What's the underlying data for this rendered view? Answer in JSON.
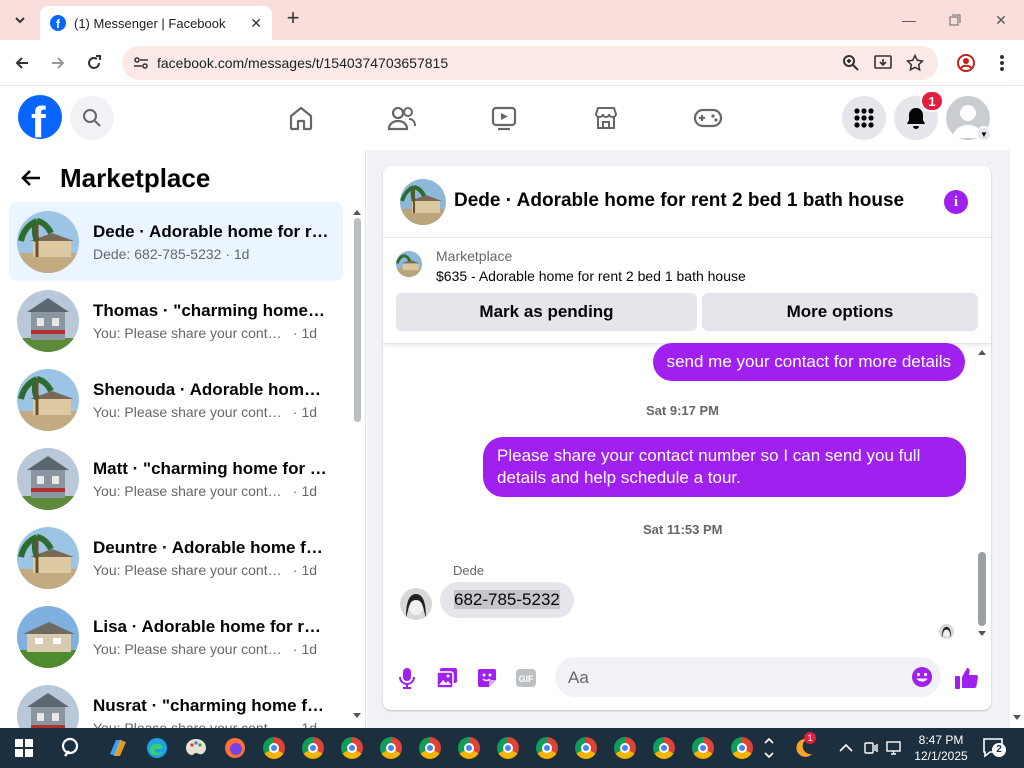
{
  "browser": {
    "tab_title": "(1) Messenger | Facebook",
    "url": "facebook.com/messages/t/1540374703657815"
  },
  "header": {
    "notification_count": "1"
  },
  "left_panel": {
    "title": "Marketplace",
    "conversations": [
      {
        "name": "Dede · Adorable home for re...",
        "preview": "Dede: 682-785-5232",
        "time": "1d",
        "thumb": "palm"
      },
      {
        "name": "Thomas · \"charming home f...",
        "preview": "You: Please share your contact ...",
        "time": "1d",
        "thumb": "gray"
      },
      {
        "name": "Shenouda · Adorable home ...",
        "preview": "You: Please share your contact ...",
        "time": "1d",
        "thumb": "palm"
      },
      {
        "name": "Matt · \"charming home for r...",
        "preview": "You: Please share your contact ...",
        "time": "1d",
        "thumb": "gray"
      },
      {
        "name": "Deuntre · Adorable home fo...",
        "preview": "You: Please share your contact ...",
        "time": "1d",
        "thumb": "palm"
      },
      {
        "name": "Lisa · Adorable home for ren...",
        "preview": "You: Please share your contact ...",
        "time": "1d",
        "thumb": "beige"
      },
      {
        "name": "Nusrat · \"charming home fo...",
        "preview": "You: Please share your contact ...",
        "time": "1d",
        "thumb": "gray"
      }
    ]
  },
  "chat": {
    "title": "Dede · Adorable home for rent 2 bed 1 bath house",
    "marketplace_label": "Marketplace",
    "listing": "$635 - Adorable home for rent 2 bed 1 bath house",
    "mark_pending_label": "Mark as pending",
    "more_options_label": "More options",
    "messages": {
      "out_1": "send me your contact for more details",
      "timestamp_1": "Sat 9:17 PM",
      "out_2_line1": "Please share your contact number so I can send you full",
      "out_2_line2": "details and help schedule a tour.",
      "timestamp_2": "Sat 11:53 PM",
      "sender": "Dede",
      "in_1": "682-785-5232"
    },
    "composer_placeholder": "Aa"
  },
  "taskbar": {
    "time": "8:47 PM",
    "date": "12/1/2025",
    "notifications": "2",
    "tray_badge": "1"
  },
  "colors": {
    "fb_blue": "#0866ff",
    "messenger_purple": "#a020f0",
    "tab_bar": "#f9dedc",
    "badge_red": "#e41e3f"
  }
}
